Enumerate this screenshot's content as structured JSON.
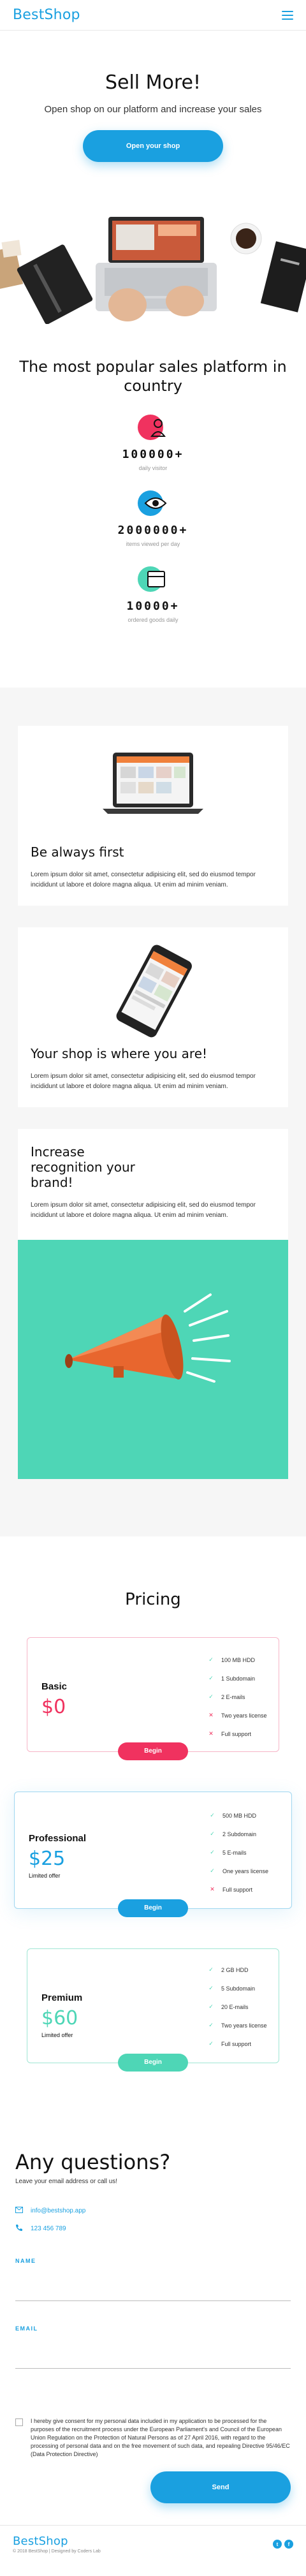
{
  "header": {
    "logo": "BestShop",
    "menu_icon": "hamburger-icon"
  },
  "hero": {
    "title": "Sell More!",
    "subtitle": "Open shop on our platform and increase your sales",
    "cta": "Open your shop"
  },
  "popular": {
    "title": "The most popular sales platform in country",
    "stats": [
      {
        "icon": "user-icon",
        "value": "100000+",
        "label": "daily visitor",
        "color": "#f0325f"
      },
      {
        "icon": "eye-icon",
        "value": "2000000+",
        "label": "items viewed per day",
        "color": "#1aa0e0"
      },
      {
        "icon": "cart-icon",
        "value": "10000+",
        "label": "ordered goods daily",
        "color": "#4ed6b6"
      }
    ]
  },
  "features": [
    {
      "title": "Be always first",
      "text": "Lorem ipsum dolor sit amet, consectetur adipisicing elit, sed do eiusmod tempor incididunt ut labore et dolore magna aliqua. Ut enim ad minim veniam."
    },
    {
      "title": "Your shop is where you are!",
      "text": "Lorem ipsum dolor sit amet, consectetur adipisicing elit, sed do eiusmod tempor incididunt ut labore et dolore magna aliqua. Ut enim ad minim veniam."
    },
    {
      "title": "Increase recognition your brand!",
      "text": "Lorem ipsum dolor sit amet, consectetur adipisicing elit, sed do eiusmod tempor incididunt ut labore et dolore magna aliqua. Ut enim ad minim veniam."
    }
  ],
  "pricing": {
    "title": "Pricing",
    "plans": [
      {
        "name": "Basic",
        "price": "$0",
        "sub": "",
        "color": "#f0325f",
        "button": "Begin",
        "features": [
          {
            "text": "100 MB HDD",
            "ok": true
          },
          {
            "text": "1 Subdomain",
            "ok": true
          },
          {
            "text": "2 E-mails",
            "ok": true
          },
          {
            "text": "Two years license",
            "ok": false
          },
          {
            "text": "Full support",
            "ok": false
          }
        ]
      },
      {
        "name": "Professional",
        "price": "$25",
        "sub": "Limited offer",
        "color": "#1aa0e0",
        "button": "Begin",
        "features": [
          {
            "text": "500 MB HDD",
            "ok": true
          },
          {
            "text": "2 Subdomain",
            "ok": true
          },
          {
            "text": "5 E-mails",
            "ok": true
          },
          {
            "text": "One years license",
            "ok": true
          },
          {
            "text": "Full support",
            "ok": false
          }
        ]
      },
      {
        "name": "Premium",
        "price": "$60",
        "sub": "Limited offer",
        "color": "#4ed6b6",
        "button": "Begin",
        "features": [
          {
            "text": "2 GB HDD",
            "ok": true
          },
          {
            "text": "5 Subdomain",
            "ok": true
          },
          {
            "text": "20 E-mails",
            "ok": true
          },
          {
            "text": "Two years license",
            "ok": true
          },
          {
            "text": "Full support",
            "ok": true
          }
        ]
      }
    ]
  },
  "faq": {
    "title": "Any questions?",
    "lead": "Leave your email address or call us!",
    "email": "info@bestshop.app",
    "phone": "123 456 789",
    "name_label": "NAME",
    "email_label": "EMAIL",
    "consent": "I hereby give consent for my personal data included in my application to be processed for the purposes of the recruitment process under the European Parliament's and Council of the European Union Regulation on the Protection of Natural Persons as of 27 April 2016, with regard to the processing of personal data and on the free movement of such data, and repealing Directive 95/46/EC (Data Protection Directive)",
    "send": "Send"
  },
  "footer": {
    "logo": "BestShop",
    "copyright": "© 2018 BestShop | Designed by Coders Lab",
    "social": [
      "twitter-icon",
      "facebook-icon"
    ]
  },
  "colors": {
    "accent": "#1aa0e0",
    "pink": "#f0325f",
    "mint": "#4ed6b6"
  }
}
